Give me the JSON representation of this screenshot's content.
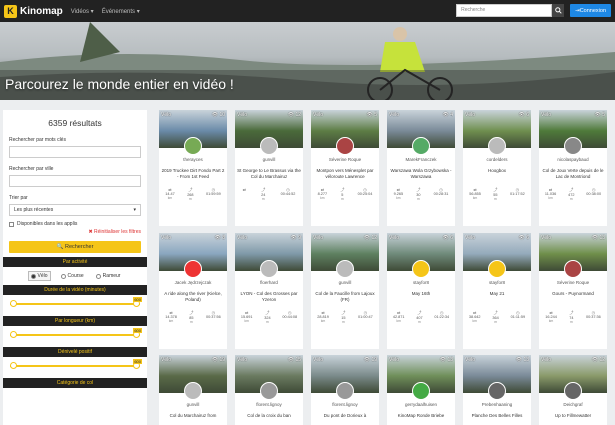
{
  "nav": {
    "brand": "Kinomap",
    "videos": "Vidéos ▾",
    "events": "Événements ▾",
    "search_placeholder": "Recherche",
    "login": "Connexion"
  },
  "hero": {
    "title": "Parcourez le monde entier en vidéo !"
  },
  "sidebar": {
    "count": "6359 résultats",
    "kw_label": "Rechercher par mots clés",
    "city_label": "Rechercher par ville",
    "sort_label": "Trier par",
    "sort_value": "Les plus récentes",
    "apps_label": "Disponibles dans les applis",
    "reset": "✖ Réinitialiser les filtres",
    "search_btn": "🔍 Rechercher",
    "activity": "Par activité",
    "activities": [
      "Vélo",
      "Course",
      "Rameur"
    ],
    "duration": "Durée de la vidéo (minutes)",
    "length": "Par longueur (km)",
    "elevation": "Dénivelé positif",
    "category": "Catégorie de col",
    "slider_max": [
      "600",
      "600",
      "600"
    ]
  },
  "cards": [
    {
      "tag": "Vélo",
      "views": "10",
      "user": "therayces",
      "title": "2019 Truckee Dirt Fondo Part 2 - From 1st Feed",
      "stats": [
        [
          "14.47",
          "km"
        ],
        [
          "268",
          "m"
        ],
        [
          "01:59:59",
          ""
        ]
      ],
      "img": "#6a8aa8",
      "av": "#7a5"
    },
    {
      "tag": "Vélo",
      "views": "12",
      "user": "gunvill",
      "title": "St George to Le Brassus via the Col du Marchairuz",
      "stats": [
        [
          "",
          "",
          ""
        ],
        [
          "24",
          "m"
        ],
        [
          "00:44:52",
          ""
        ]
      ],
      "img": "#4a6a3a",
      "av": "#bbb"
    },
    {
      "tag": "Vélo",
      "views": "5",
      "user": "Séverine Roque",
      "title": "Montpon vers Ménesplet par véloroute Lawrence",
      "stats": [
        [
          "8.277",
          "km"
        ],
        [
          "5",
          "m"
        ],
        [
          "00:25:04",
          ""
        ]
      ],
      "img": "#5d7d45",
      "av": "#a44"
    },
    {
      "tag": "Vélo",
      "views": "4",
      "user": "MarekFranczek",
      "title": "Warszawa Wola Grzybowska - Warszawa",
      "stats": [
        [
          "9.265",
          "km"
        ],
        [
          "30",
          "m"
        ],
        [
          "00:28:31",
          ""
        ]
      ],
      "img": "#7a8a98",
      "av": "#5a6"
    },
    {
      "tag": "Vélo",
      "views": "6",
      "user": "cordelders",
      "title": "Hoogbox",
      "stats": [
        [
          "56.855",
          "km"
        ],
        [
          "55",
          "m"
        ],
        [
          "01:17:52",
          ""
        ]
      ],
      "img": "#6f8f4f",
      "av": "#bbb"
    },
    {
      "tag": "Vélo",
      "views": "5",
      "user": "nicolaspaybaud",
      "title": "Col de Joux Verte depuis de le Lac de Montriond",
      "stats": [
        [
          "11.036",
          "km"
        ],
        [
          "472",
          "m"
        ],
        [
          "00:38:00",
          ""
        ]
      ],
      "img": "#4f7a3a",
      "av": "#888"
    },
    {
      "tag": "Vélo",
      "views": "8",
      "user": "Jacek Jędrzejczak",
      "title": "A ride along the river (Kielce, Poland)",
      "stats": [
        [
          "14.378",
          "km"
        ],
        [
          "85",
          "m"
        ],
        [
          "00:37:56",
          ""
        ]
      ],
      "img": "#8aa6bf",
      "av": "#e33"
    },
    {
      "tag": "Vélo",
      "views": "9",
      "user": "floerhard",
      "title": "LYON - Col des Grosses par Yzeron",
      "stats": [
        [
          "15.691",
          "km"
        ],
        [
          "324",
          "m"
        ],
        [
          "00:44:08",
          ""
        ]
      ],
      "img": "#7f99a8",
      "av": "#bbb"
    },
    {
      "tag": "Vélo",
      "views": "12",
      "user": "gunvill",
      "title": "Col de la Faucille from Lajoux (FR)",
      "stats": [
        [
          "28.819",
          "km"
        ],
        [
          "15",
          "m"
        ],
        [
          "01:00:47",
          ""
        ]
      ],
      "img": "#5e8060",
      "av": "#bbb"
    },
    {
      "tag": "Vélo",
      "views": "6",
      "user": "stayfor8",
      "title": "May 16th",
      "stats": [
        [
          "42.871",
          "km"
        ],
        [
          "407",
          "m"
        ],
        [
          "01:22:34",
          ""
        ]
      ],
      "img": "#6f8a7a",
      "av": "#f5c518"
    },
    {
      "tag": "Vélo",
      "views": "6",
      "user": "stayfor8",
      "title": "May 21",
      "stats": [
        [
          "38.642",
          "km"
        ],
        [
          "364",
          "m"
        ],
        [
          "01:11:59",
          ""
        ]
      ],
      "img": "#94aabb",
      "av": "#f5c518"
    },
    {
      "tag": "Vélo",
      "views": "13",
      "user": "Séverine Roque",
      "title": "Gours - Puynormand",
      "stats": [
        [
          "16.244",
          "km"
        ],
        [
          "74",
          "m"
        ],
        [
          "00:37:36",
          ""
        ]
      ],
      "img": "#6f8f4a",
      "av": "#a44"
    },
    {
      "tag": "Vélo",
      "views": "19",
      "user": "gunvill",
      "title": "Col du Marchairuz from",
      "stats": [
        [
          "",
          "",
          ""
        ],
        [
          "",
          ""
        ],
        [
          "",
          ""
        ]
      ],
      "img": "#5a6a48",
      "av": "#bbb"
    },
    {
      "tag": "Vélo",
      "views": "15",
      "user": "florent.lignoy",
      "title": "Col de la croix du ban",
      "stats": [
        [
          "",
          "",
          ""
        ],
        [
          "",
          ""
        ],
        [
          "",
          ""
        ]
      ],
      "img": "#6a7a60",
      "av": "#999"
    },
    {
      "tag": "Vélo",
      "views": "19",
      "user": "florent.lignoy",
      "title": "Du pont de Dorieux à",
      "stats": [
        [
          "",
          "",
          ""
        ],
        [
          "",
          ""
        ],
        [
          "",
          ""
        ]
      ],
      "img": "#7a8a8a",
      "av": "#999"
    },
    {
      "tag": "Vélo",
      "views": "13",
      "user": "gerrydaalhuisen",
      "title": "KinoMap Ronde Briebe",
      "stats": [
        [
          "",
          "",
          ""
        ],
        [
          "",
          ""
        ],
        [
          "",
          ""
        ]
      ],
      "img": "#6f8f5a",
      "av": "#4a4"
    },
    {
      "tag": "Vélo",
      "views": "13",
      "user": "Prebenhaaning",
      "title": "Planche Des Belles Filles",
      "stats": [
        [
          "",
          "",
          ""
        ],
        [
          "",
          ""
        ],
        [
          "",
          ""
        ]
      ],
      "img": "#7a8a98",
      "av": "#666"
    },
    {
      "tag": "Vélo",
      "views": "12",
      "user": "Deichgraf",
      "title": "Up to Fillmewatter",
      "stats": [
        [
          "",
          "",
          ""
        ],
        [
          "",
          ""
        ],
        [
          "",
          ""
        ]
      ],
      "img": "#8a9a6a",
      "av": "#666"
    }
  ]
}
